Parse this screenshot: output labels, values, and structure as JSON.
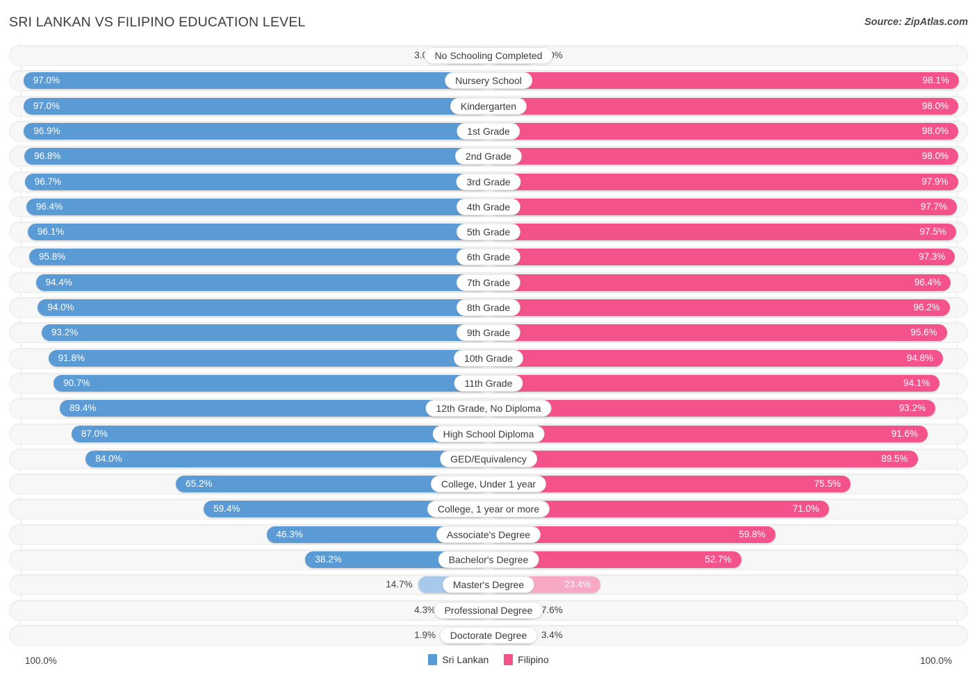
{
  "header": {
    "title": "SRI LANKAN VS FILIPINO EDUCATION LEVEL",
    "source": "Source: ZipAtlas.com"
  },
  "legend": {
    "left": {
      "label": "Sri Lankan",
      "color": "#5b9bd5"
    },
    "right": {
      "label": "Filipino",
      "color": "#f4528b"
    }
  },
  "axis": {
    "left_max": "100.0%",
    "right_max": "100.0%"
  },
  "chart_data": {
    "type": "bar",
    "orientation": "horizontal-diverging",
    "title": "SRI LANKAN VS FILIPINO EDUCATION LEVEL",
    "xlabel": "",
    "ylabel": "",
    "xlim": [
      0,
      100
    ],
    "grid": false,
    "legend_position": "bottom-center",
    "categories": [
      "No Schooling Completed",
      "Nursery School",
      "Kindergarten",
      "1st Grade",
      "2nd Grade",
      "3rd Grade",
      "4th Grade",
      "5th Grade",
      "6th Grade",
      "7th Grade",
      "8th Grade",
      "9th Grade",
      "10th Grade",
      "11th Grade",
      "12th Grade, No Diploma",
      "High School Diploma",
      "GED/Equivalency",
      "College, Under 1 year",
      "College, 1 year or more",
      "Associate's Degree",
      "Bachelor's Degree",
      "Master's Degree",
      "Professional Degree",
      "Doctorate Degree"
    ],
    "series": [
      {
        "name": "Sri Lankan",
        "color": "#5b9bd5",
        "values": [
          3.0,
          97.0,
          97.0,
          96.9,
          96.8,
          96.7,
          96.4,
          96.1,
          95.8,
          94.4,
          94.0,
          93.2,
          91.8,
          90.7,
          89.4,
          87.0,
          84.0,
          65.2,
          59.4,
          46.3,
          38.2,
          14.7,
          4.3,
          1.9
        ],
        "labels": [
          "3.0%",
          "97.0%",
          "97.0%",
          "96.9%",
          "96.8%",
          "96.7%",
          "96.4%",
          "96.1%",
          "95.8%",
          "94.4%",
          "94.0%",
          "93.2%",
          "91.8%",
          "90.7%",
          "89.4%",
          "87.0%",
          "84.0%",
          "65.2%",
          "59.4%",
          "46.3%",
          "38.2%",
          "14.7%",
          "4.3%",
          "1.9%"
        ]
      },
      {
        "name": "Filipino",
        "color": "#f4528b",
        "values": [
          2.0,
          98.1,
          98.0,
          98.0,
          98.0,
          97.9,
          97.7,
          97.5,
          97.3,
          96.4,
          96.2,
          95.6,
          94.8,
          94.1,
          93.2,
          91.6,
          89.5,
          75.5,
          71.0,
          59.8,
          52.7,
          23.4,
          7.6,
          3.4
        ],
        "labels": [
          "2.0%",
          "98.1%",
          "98.0%",
          "98.0%",
          "98.0%",
          "97.9%",
          "97.7%",
          "97.5%",
          "97.3%",
          "96.4%",
          "96.2%",
          "95.6%",
          "94.8%",
          "94.1%",
          "93.2%",
          "91.6%",
          "89.5%",
          "75.5%",
          "71.0%",
          "59.8%",
          "52.7%",
          "23.4%",
          "7.6%",
          "3.4%"
        ]
      }
    ]
  }
}
